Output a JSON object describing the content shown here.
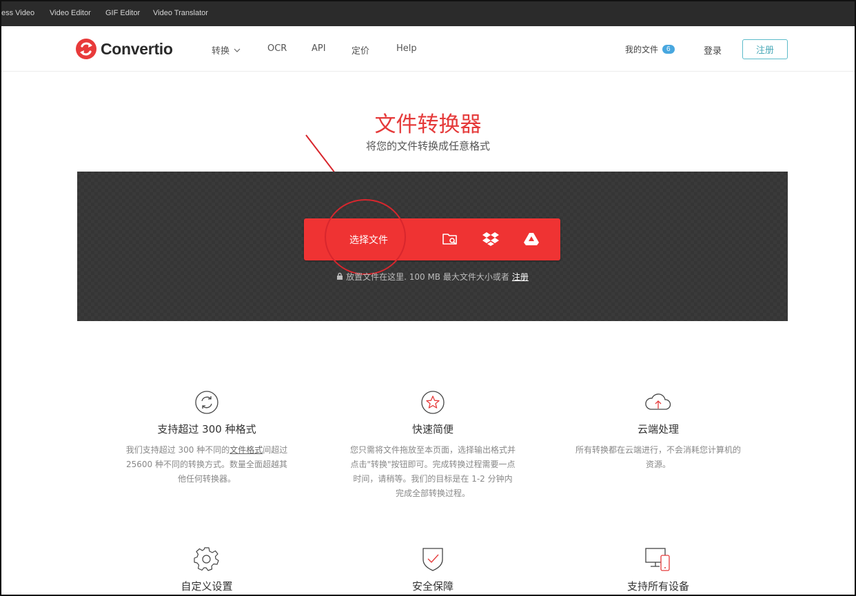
{
  "topbar": {
    "links": [
      "ess Video",
      "Video Editor",
      "GIF Editor",
      "Video Translator"
    ]
  },
  "header": {
    "brand": "Convertio",
    "nav": [
      {
        "label": "转换",
        "has_dropdown": true
      },
      {
        "label": "OCR"
      },
      {
        "label": "API"
      },
      {
        "label": "定价"
      },
      {
        "label": "Help"
      }
    ],
    "my_files_label": "我的文件",
    "my_files_count": "6",
    "login_label": "登录",
    "register_label": "注册"
  },
  "hero": {
    "title": "文件转换器",
    "subtitle": "将您的文件转换成任意格式"
  },
  "upload": {
    "choose_label": "选择文件",
    "sources": [
      "folder-search-icon",
      "dropbox-icon",
      "google-drive-icon"
    ],
    "drop_note": "放置文件在这里. 100 MB 最大文件大小或者",
    "drop_note_link": "注册"
  },
  "features": [
    {
      "icon": "refresh-icon",
      "title": "支持超过 300 种格式",
      "desc_before": "我们支持超过 300 种不同的",
      "desc_link": "文件格式",
      "desc_after": "间超过 25600 种不同的转换方式。数量全面超越其他任何转换器。"
    },
    {
      "icon": "star-icon",
      "title": "快速简便",
      "desc": "您只需将文件拖放至本页面，选择输出格式并点击\"转换\"按钮即可。完成转换过程需要一点时间，请稍等。我们的目标是在 1-2 分钟内完成全部转换过程。"
    },
    {
      "icon": "cloud-upload-icon",
      "title": "云端处理",
      "desc": "所有转换都在云端进行，不会消耗您计算机的资源。"
    },
    {
      "icon": "gear-icon",
      "title": "自定义设置"
    },
    {
      "icon": "shield-check-icon",
      "title": "安全保障"
    },
    {
      "icon": "devices-icon",
      "title": "支持所有设备"
    }
  ],
  "colors": {
    "brand_red": "#ef3333",
    "title_red": "#e53a3a",
    "register_teal": "#4aa9b8",
    "badge_blue": "#48a7df",
    "panel_dark": "#3a3a3a",
    "annotation_red": "#d8262d"
  }
}
